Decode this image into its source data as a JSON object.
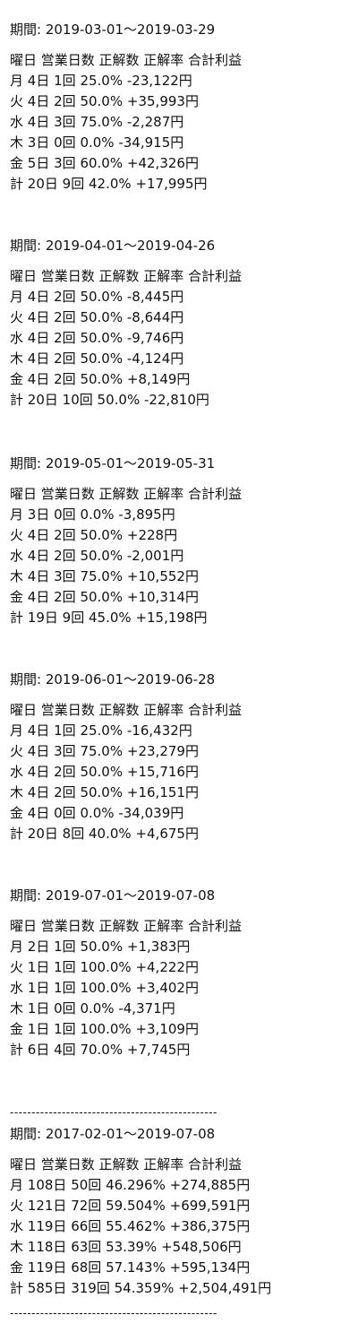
{
  "sections": [
    {
      "period": "期間: 2019-03-01〜2019-03-29",
      "header": "曜日 営業日数 正解数 正解率 合計利益",
      "rows": [
        {
          "day": "月",
          "days": "4日",
          "hits": "1回",
          "rate": "25.0%",
          "profit": "-23,122円"
        },
        {
          "day": "火",
          "days": "4日",
          "hits": "2回",
          "rate": "50.0%",
          "profit": "+35,993円"
        },
        {
          "day": "水",
          "days": "4日",
          "hits": "3回",
          "rate": "75.0%",
          "profit": "-2,287円"
        },
        {
          "day": "木",
          "days": "3日",
          "hits": "0回",
          "rate": "0.0%",
          "profit": "-34,915円"
        },
        {
          "day": "金",
          "days": "5日",
          "hits": "3回",
          "rate": "60.0%",
          "profit": "+42,326円"
        },
        {
          "day": "計",
          "days": "20日",
          "hits": "9回",
          "rate": "42.0%",
          "profit": "+17,995円"
        }
      ]
    },
    {
      "period": "期間: 2019-04-01〜2019-04-26",
      "header": "曜日 営業日数 正解数 正解率 合計利益",
      "rows": [
        {
          "day": "月",
          "days": "4日",
          "hits": "2回",
          "rate": "50.0%",
          "profit": "-8,445円"
        },
        {
          "day": "火",
          "days": "4日",
          "hits": "2回",
          "rate": "50.0%",
          "profit": "-8,644円"
        },
        {
          "day": "水",
          "days": "4日",
          "hits": "2回",
          "rate": "50.0%",
          "profit": "-9,746円"
        },
        {
          "day": "木",
          "days": "4日",
          "hits": "2回",
          "rate": "50.0%",
          "profit": "-4,124円"
        },
        {
          "day": "金",
          "days": "4日",
          "hits": "2回",
          "rate": "50.0%",
          "profit": "+8,149円"
        },
        {
          "day": "計",
          "days": "20日",
          "hits": "10回",
          "rate": "50.0%",
          "profit": "-22,810円"
        }
      ]
    },
    {
      "period": "期間: 2019-05-01〜2019-05-31",
      "header": "曜日 営業日数 正解数 正解率 合計利益",
      "rows": [
        {
          "day": "月",
          "days": "3日",
          "hits": "0回",
          "rate": "0.0%",
          "profit": "-3,895円"
        },
        {
          "day": "火",
          "days": "4日",
          "hits": "2回",
          "rate": "50.0%",
          "profit": "+228円"
        },
        {
          "day": "水",
          "days": "4日",
          "hits": "2回",
          "rate": "50.0%",
          "profit": "-2,001円"
        },
        {
          "day": "木",
          "days": "4日",
          "hits": "3回",
          "rate": "75.0%",
          "profit": "+10,552円"
        },
        {
          "day": "金",
          "days": "4日",
          "hits": "2回",
          "rate": "50.0%",
          "profit": "+10,314円"
        },
        {
          "day": "計",
          "days": "19日",
          "hits": "9回",
          "rate": "45.0%",
          "profit": "+15,198円"
        }
      ]
    },
    {
      "period": "期間: 2019-06-01〜2019-06-28",
      "header": "曜日 営業日数 正解数 正解率 合計利益",
      "rows": [
        {
          "day": "月",
          "days": "4日",
          "hits": "1回",
          "rate": "25.0%",
          "profit": "-16,432円"
        },
        {
          "day": "火",
          "days": "4日",
          "hits": "3回",
          "rate": "75.0%",
          "profit": "+23,279円"
        },
        {
          "day": "水",
          "days": "4日",
          "hits": "2回",
          "rate": "50.0%",
          "profit": "+15,716円"
        },
        {
          "day": "木",
          "days": "4日",
          "hits": "2回",
          "rate": "50.0%",
          "profit": "+16,151円"
        },
        {
          "day": "金",
          "days": "4日",
          "hits": "0回",
          "rate": "0.0%",
          "profit": "-34,039円"
        },
        {
          "day": "計",
          "days": "20日",
          "hits": "8回",
          "rate": "40.0%",
          "profit": "+4,675円"
        }
      ]
    },
    {
      "period": "期間: 2019-07-01〜2019-07-08",
      "header": "曜日 営業日数 正解数 正解率 合計利益",
      "rows": [
        {
          "day": "月",
          "days": "2日",
          "hits": "1回",
          "rate": "50.0%",
          "profit": "+1,383円"
        },
        {
          "day": "火",
          "days": "1日",
          "hits": "1回",
          "rate": "100.0%",
          "profit": "+4,222円"
        },
        {
          "day": "水",
          "days": "1日",
          "hits": "1回",
          "rate": "100.0%",
          "profit": "+3,402円"
        },
        {
          "day": "木",
          "days": "1日",
          "hits": "0回",
          "rate": "0.0%",
          "profit": "-4,371円"
        },
        {
          "day": "金",
          "days": "1日",
          "hits": "1回",
          "rate": "100.0%",
          "profit": "+3,109円"
        },
        {
          "day": "計",
          "days": "6日",
          "hits": "4回",
          "rate": "70.0%",
          "profit": "+7,745円"
        }
      ]
    },
    {
      "period": "期間: 2017-02-01〜2019-07-08",
      "header": "曜日 営業日数 正解数 正解率 合計利益",
      "rows": [
        {
          "day": "月",
          "days": "108日",
          "hits": "50回",
          "rate": "46.296%",
          "profit": "+274,885円"
        },
        {
          "day": "火",
          "days": "121日",
          "hits": "72回",
          "rate": "59.504%",
          "profit": "+699,591円"
        },
        {
          "day": "水",
          "days": "119日",
          "hits": "66回",
          "rate": "55.462%",
          "profit": "+386,375円"
        },
        {
          "day": "木",
          "days": "118日",
          "hits": "63回",
          "rate": "53.39%",
          "profit": "+548,506円"
        },
        {
          "day": "金",
          "days": "119日",
          "hits": "68回",
          "rate": "57.143%",
          "profit": "+595,134円"
        },
        {
          "day": "計",
          "days": "585日",
          "hits": "319回",
          "rate": "54.359%",
          "profit": "+2,504,491円"
        }
      ]
    }
  ],
  "divider": "------------------------------------------------"
}
